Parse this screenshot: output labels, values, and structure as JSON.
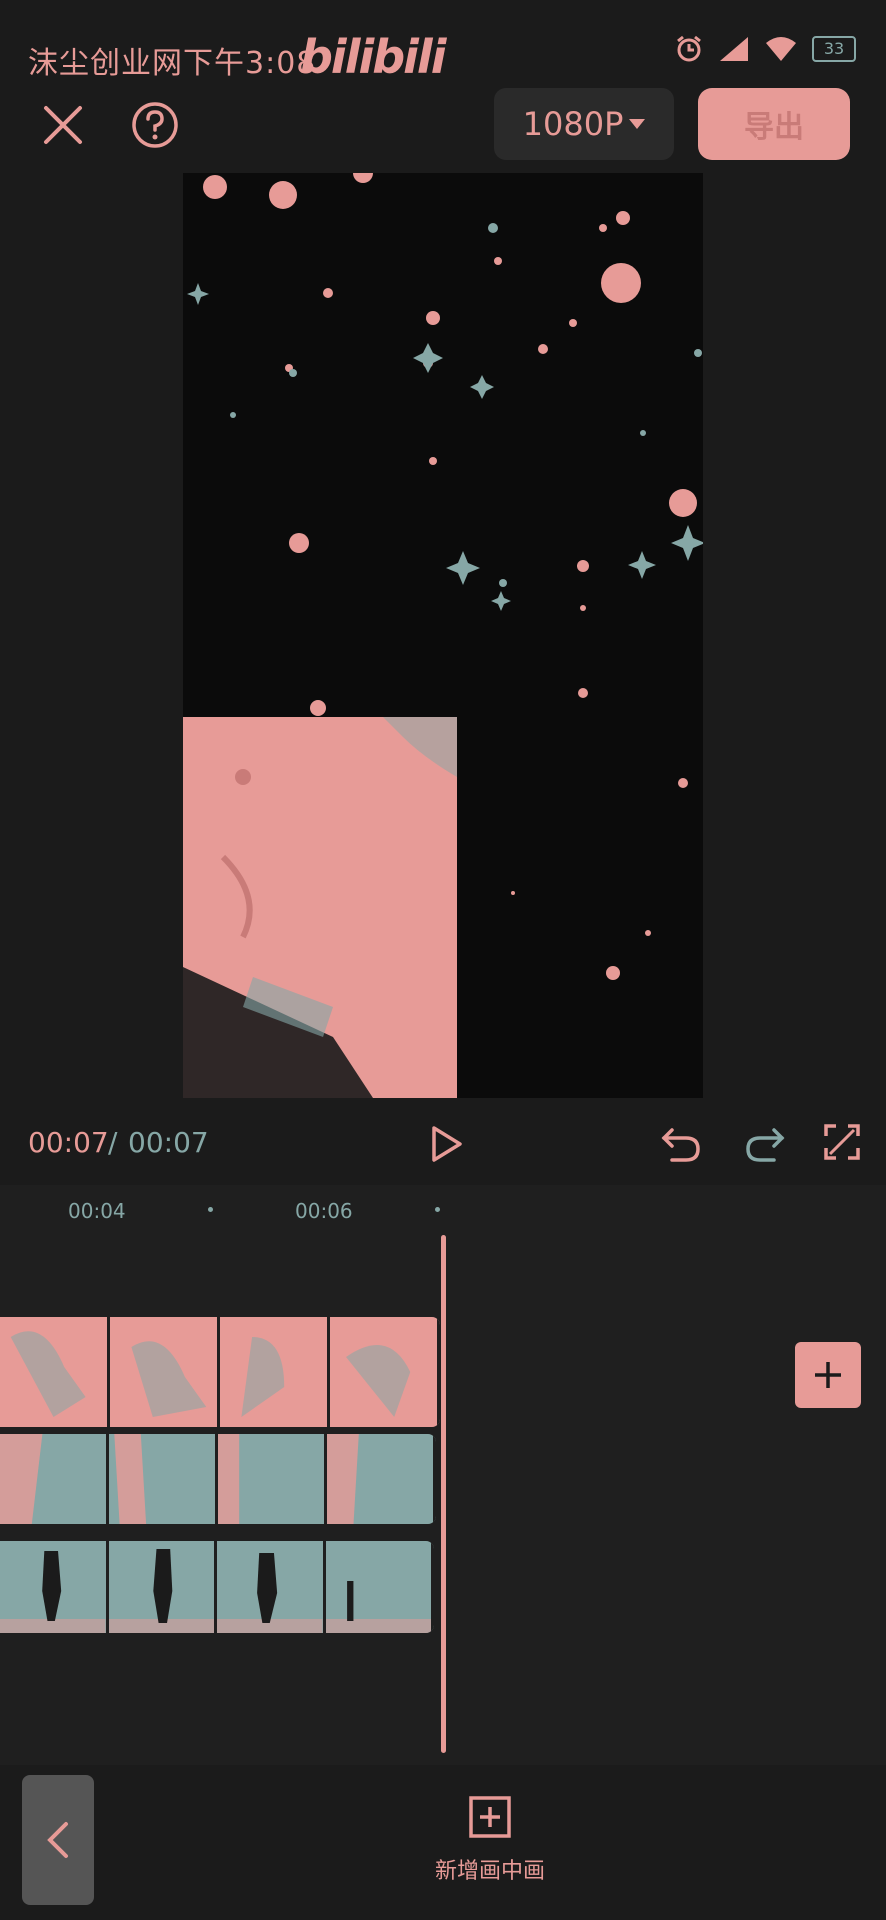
{
  "status_bar": {
    "left_text": "沫尘创业网下午3:08",
    "logo_text": "bilibili",
    "battery": "33"
  },
  "top_bar": {
    "resolution_label": "1080P",
    "export_label": "导出"
  },
  "playback": {
    "current_time": "00:07",
    "separator": "/",
    "total_time": "00:07"
  },
  "timeline": {
    "ticks": [
      "00:04",
      "00:06"
    ]
  },
  "toolbar": {
    "add_pip_label": "新增画中画"
  },
  "colors": {
    "accent": "#e79b97",
    "teal": "#86a7a6",
    "background": "#1b1b1b"
  }
}
